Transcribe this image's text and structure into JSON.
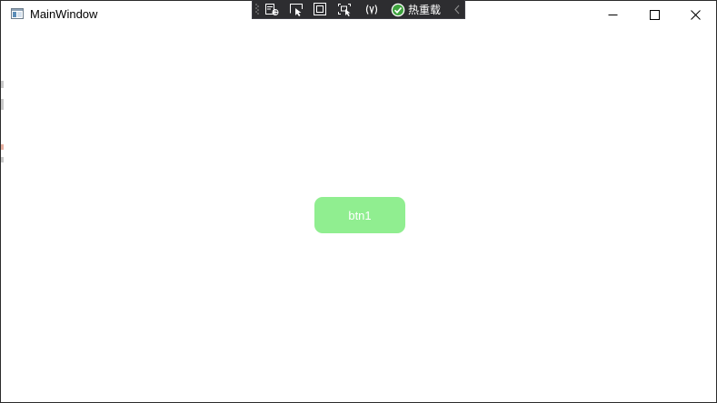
{
  "window": {
    "title": "MainWindow",
    "minimize_icon": "minimize-icon",
    "maximize_icon": "maximize-icon",
    "close_icon": "close-icon"
  },
  "devtoolbar": {
    "tools": [
      {
        "name": "live-visual-tree-icon"
      },
      {
        "name": "select-element-icon"
      },
      {
        "name": "display-layout-adorners-icon"
      },
      {
        "name": "track-focused-element-icon"
      },
      {
        "name": "binding-failures-icon"
      }
    ],
    "hot_reload_label": "热重载",
    "hot_reload_status_color": "#3fa33f"
  },
  "content": {
    "button": {
      "label": "btn1",
      "background": "#90ee90",
      "text_color": "#ffffff"
    }
  }
}
